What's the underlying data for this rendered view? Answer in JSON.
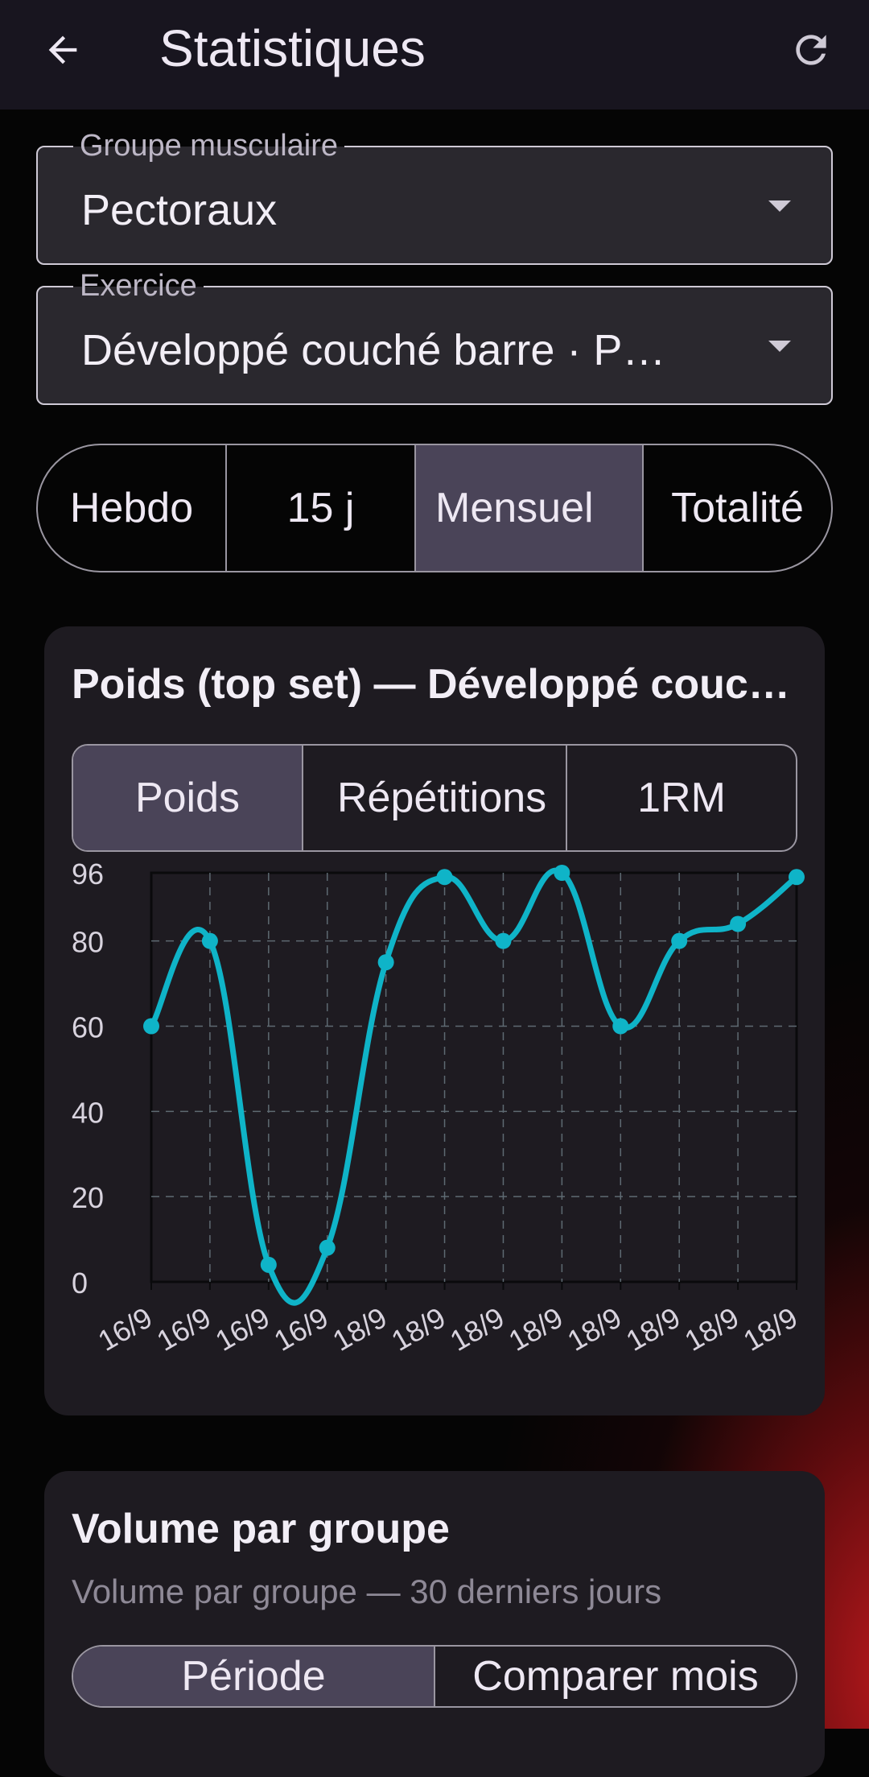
{
  "appbar": {
    "title": "Statistiques",
    "back_icon": "arrow-left-icon",
    "refresh_icon": "refresh-icon"
  },
  "muscle_group": {
    "label": "Groupe musculaire",
    "value": "Pectoraux"
  },
  "exercise": {
    "label": "Exercice",
    "value": "Développé couché barre  ·  P…"
  },
  "period_tabs": {
    "options": [
      "Hebdo",
      "15 j",
      "Mensuel",
      "Totalité"
    ],
    "selected": "Mensuel"
  },
  "weight_card": {
    "title": "Poids (top set) — Développé couc…",
    "metric_tabs": [
      "Poids",
      "Répétitions",
      "1RM"
    ],
    "selected_metric": "Poids"
  },
  "chart_data": {
    "type": "line",
    "categories": [
      "16/9",
      "16/9",
      "16/9",
      "16/9",
      "18/9",
      "18/9",
      "18/9",
      "18/9",
      "18/9",
      "18/9",
      "18/9",
      "18/9"
    ],
    "series": [
      {
        "values": [
          60,
          80,
          4,
          8,
          75,
          95,
          80,
          96,
          60,
          80,
          84,
          95
        ]
      }
    ],
    "y_ticks": [
      "0",
      "20",
      "40",
      "60",
      "80",
      "96"
    ],
    "ylim": [
      0,
      96
    ],
    "grid": true,
    "line_color": "#0FB4C8"
  },
  "volume_card": {
    "title": "Volume par groupe",
    "subtitle": "Volume par groupe — 30 derniers jours",
    "tabs": [
      "Période",
      "Comparer mois"
    ],
    "selected": "Période"
  },
  "colors": {
    "appbar_bg": "#18151F",
    "card_bg": "#1E1B21",
    "selected_seg": "#4A4458",
    "accent_red": "#C41A1E"
  }
}
